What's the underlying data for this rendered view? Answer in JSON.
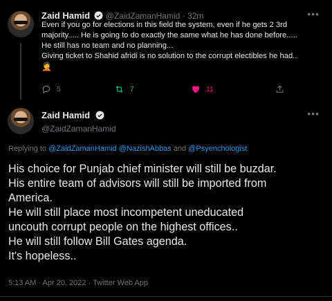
{
  "tweet1": {
    "name": "Zaid Hamid",
    "handle": "@ZaidZamanHamid",
    "sep": "·",
    "time": "32m",
    "lines": [
      "Even if you go for elections in this field the system, even if he gets 2 3rd",
      "majority..... He is going to do exactly the same what he has done before.....",
      "He still has no team and no planning...",
      "Giving ticket to Shahid afridi is no solution to the corrupt electibles he had.."
    ],
    "emoji": "🤦",
    "replies": "5",
    "retweets": "7",
    "likes": "11",
    "colors": {
      "retweet": "#00ba7c",
      "like": "#f91880",
      "muted": "#71767b"
    }
  },
  "tweet2": {
    "name": "Zaid Hamid",
    "handle": "@ZaidZamanHamid",
    "replying_prefix": "Replying to",
    "mention1": "@ZaidZamanHamid",
    "mention2": "@NazishAbbas",
    "and": "and",
    "mention3": "@Psyenchologist",
    "lines": [
      "His choice for Punjab chief minister will still be buzdar.",
      "His entire team of advisors will still be imported from",
      "America.",
      "He will still place most incompetent uneducated",
      "uncouth corrupt people on the highest offices..",
      "He will still follow Bill Gates agenda.",
      "It's hopeless.."
    ],
    "meta": "5:13 AM · Apr 20, 2022 · Twitter Web App",
    "link_color": "#1d9bf0"
  }
}
